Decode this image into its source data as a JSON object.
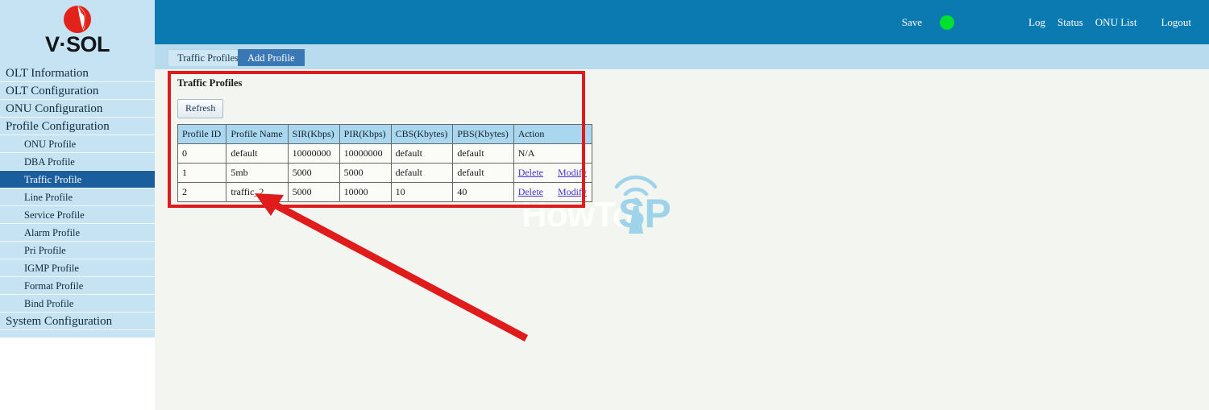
{
  "brand": {
    "name": "V·SOL",
    "logo_icon": "vsol-sphere-logo-icon"
  },
  "topbar": {
    "save_label": "Save",
    "status_indicator_icon": "green-status-dot-icon",
    "status_indicator_color": "#00e02e",
    "links": {
      "log": "Log",
      "status": "Status",
      "onu_list": "ONU List",
      "logout": "Logout"
    }
  },
  "sidebar": {
    "items": [
      {
        "label": "OLT Information",
        "level": "main",
        "active": false
      },
      {
        "label": "OLT Configuration",
        "level": "main",
        "active": false
      },
      {
        "label": "ONU Configuration",
        "level": "main",
        "active": false
      },
      {
        "label": "Profile Configuration",
        "level": "main",
        "active": false
      },
      {
        "label": "ONU Profile",
        "level": "sub",
        "active": false
      },
      {
        "label": "DBA Profile",
        "level": "sub",
        "active": false
      },
      {
        "label": "Traffic Profile",
        "level": "sub",
        "active": true
      },
      {
        "label": "Line Profile",
        "level": "sub",
        "active": false
      },
      {
        "label": "Service Profile",
        "level": "sub",
        "active": false
      },
      {
        "label": "Alarm Profile",
        "level": "sub",
        "active": false
      },
      {
        "label": "Pri Profile",
        "level": "sub",
        "active": false
      },
      {
        "label": "IGMP Profile",
        "level": "sub",
        "active": false
      },
      {
        "label": "Format Profile",
        "level": "sub",
        "active": false
      },
      {
        "label": "Bind Profile",
        "level": "sub",
        "active": false
      },
      {
        "label": "System Configuration",
        "level": "main",
        "active": false
      }
    ]
  },
  "tabs": [
    {
      "label": "Traffic Profiles",
      "active": false
    },
    {
      "label": "Add Profile",
      "active": true
    }
  ],
  "panel": {
    "title": "Traffic Profiles",
    "refresh_label": "Refresh",
    "table": {
      "columns": [
        "Profile ID",
        "Profile Name",
        "SIR(Kbps)",
        "PIR(Kbps)",
        "CBS(Kbytes)",
        "PBS(Kbytes)",
        "Action"
      ],
      "rows": [
        {
          "profile_id": "0",
          "profile_name": "default",
          "sir": "10000000",
          "pir": "10000000",
          "cbs": "default",
          "pbs": "default",
          "action_text": "N/A",
          "has_links": false
        },
        {
          "profile_id": "1",
          "profile_name": "5mb",
          "sir": "5000",
          "pir": "5000",
          "cbs": "default",
          "pbs": "default",
          "action_text": "",
          "has_links": true,
          "delete_label": "Delete",
          "modify_label": "Modify"
        },
        {
          "profile_id": "2",
          "profile_name": "traffic_2",
          "sir": "5000",
          "pir": "10000",
          "cbs": "10",
          "pbs": "40",
          "action_text": "",
          "has_links": true,
          "delete_label": "Delete",
          "modify_label": "Modify"
        }
      ]
    }
  },
  "watermark": {
    "faint_text": "HowTo",
    "blue_text": "SP",
    "tower_icon": "wifi-tower-icon",
    "blue_color": "#9ed3ea"
  },
  "annotations": {
    "highlight_box_color": "#e01b1b",
    "arrow_color": "#e01b1b",
    "arrow_points_to": "traffic_2"
  }
}
